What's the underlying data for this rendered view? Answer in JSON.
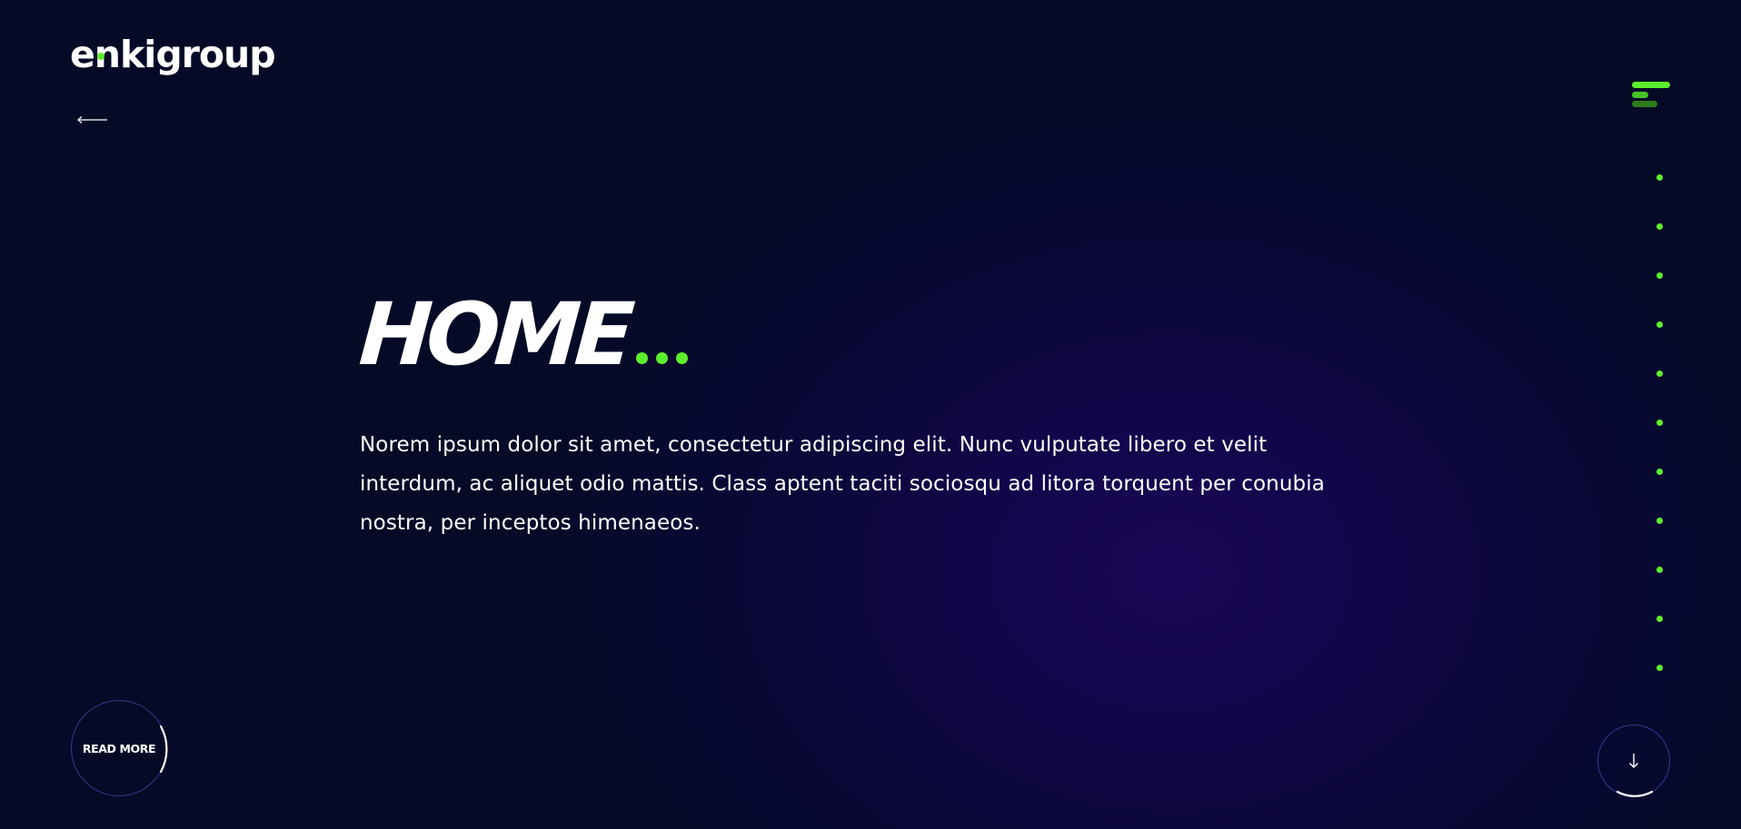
{
  "logo": {
    "text": "enkigroup"
  },
  "colors": {
    "accent": "#5cef2d",
    "background": "#050a26",
    "glow": "#1a0857",
    "ring": "#3c3590"
  },
  "header": {
    "back_icon": "arrow-left-icon",
    "menu_icon": "hamburger-menu-icon"
  },
  "nav": {
    "section_dots": 11
  },
  "hero": {
    "title": "HOME",
    "text": "Norem ipsum dolor sit amet, consectetur adipiscing elit. Nunc vulputate libero et velit interdum, ac aliquet odio mattis. Class aptent taciti sociosqu ad litora torquent per conubia nostra, per inceptos himenaeos."
  },
  "actions": {
    "read_more": "READ MORE",
    "scroll_icon": "arrow-down-icon"
  }
}
